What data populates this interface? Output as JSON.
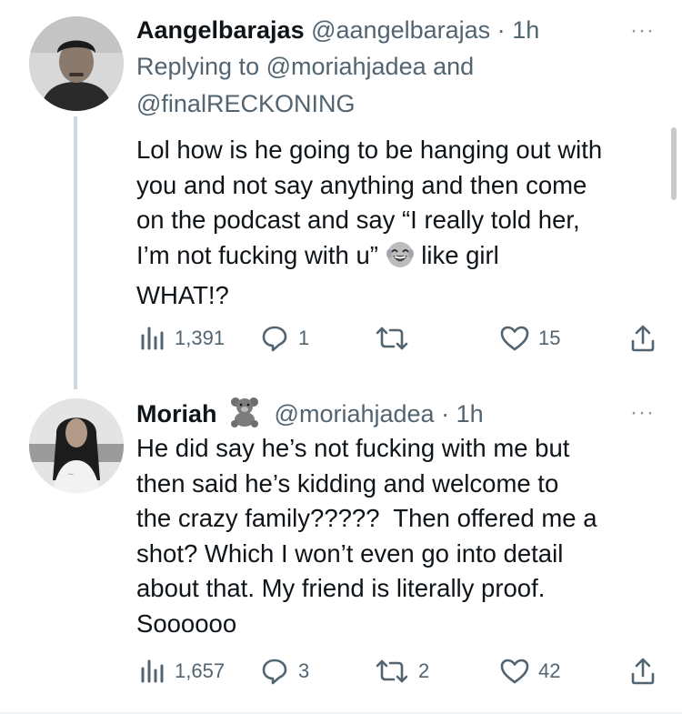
{
  "tweets": [
    {
      "name": "Aangelbarajas",
      "handle": "@aangelbarajas",
      "dot": "·",
      "time": "1h",
      "replying_to_prefix": "Replying to ",
      "replying_to_1": "@moriahjadea",
      "replying_to_and": " and",
      "replying_to_2": "@finalRECKONING",
      "body_lines": [
        "Lol how is he going to be hanging out with",
        "you and not say anything and then come",
        "on the podcast and say “I really told her,",
        "I’m not fucking with u”",
        " like girl",
        "WHAT!?"
      ],
      "views": "1,391",
      "replies": "1",
      "retweets": "",
      "likes": "15"
    },
    {
      "name": "Moriah",
      "name_emoji": "teddy-bear",
      "handle": "@moriahjadea",
      "dot": "·",
      "time": "1h",
      "body_lines": [
        "He did say he’s not fucking with me but",
        "then said he’s kidding and welcome to",
        "the crazy family?????  Then offered me a",
        "shot? Which I won’t even go into detail",
        "about that. My friend is literally proof.",
        "Soooooo"
      ],
      "views": "1,657",
      "replies": "3",
      "retweets": "2",
      "likes": "42"
    }
  ],
  "more_label": "···",
  "colors": {
    "text": "#0f1419",
    "secondary": "#536471",
    "line": "#cfd9de"
  },
  "icons": [
    "views-icon",
    "reply-icon",
    "retweet-icon",
    "like-icon",
    "share-icon",
    "laughing-emoji",
    "teddy-bear-emoji"
  ]
}
